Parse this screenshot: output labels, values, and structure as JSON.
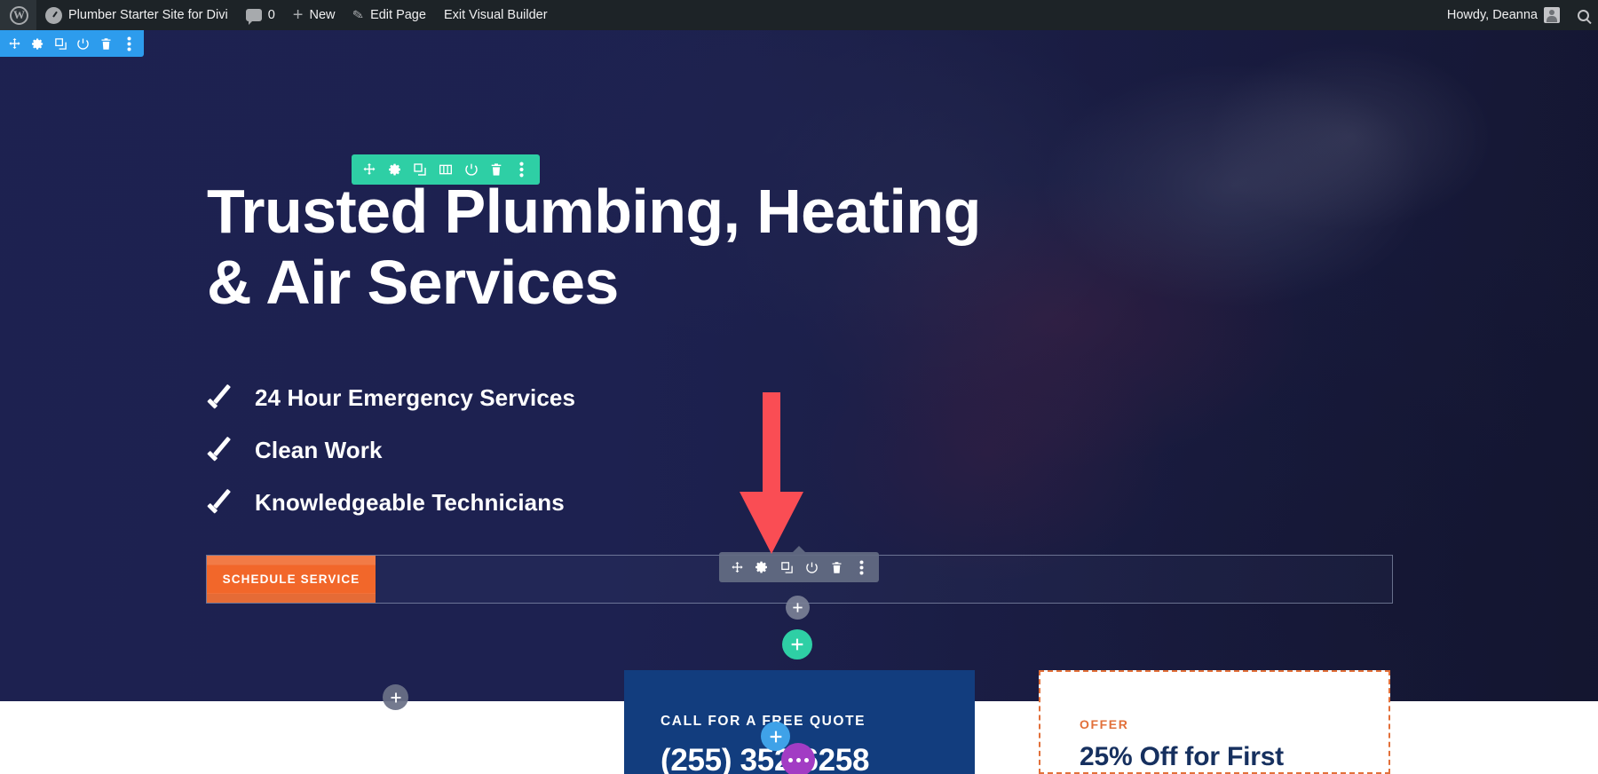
{
  "adminbar": {
    "wp_logo": "wordpress-logo-icon",
    "site_name": "Plumber Starter Site for Divi",
    "comments_count": "0",
    "new_label": "New",
    "edit_page_label": "Edit Page",
    "exit_visual_builder_label": "Exit Visual Builder",
    "howdy": "Howdy, Deanna",
    "search_icon": "search-icon"
  },
  "toolbars": {
    "section": {
      "color": "#2d9ced",
      "buttons": [
        "move-icon",
        "gear-icon",
        "duplicate-icon",
        "disable-icon",
        "trash-icon",
        "more-options-icon"
      ]
    },
    "row": {
      "color": "#2ecfa5",
      "buttons": [
        "move-icon",
        "gear-icon",
        "duplicate-icon",
        "columns-icon",
        "disable-icon",
        "trash-icon",
        "more-options-icon"
      ]
    },
    "module": {
      "color": "#646c83",
      "buttons": [
        "move-icon",
        "gear-icon",
        "duplicate-icon",
        "disable-icon",
        "trash-icon",
        "more-options-icon"
      ]
    }
  },
  "hero": {
    "title": "Trusted Plumbing, Heating & Air Services",
    "features": [
      "24 Hour Emergency Services",
      "Clean Work",
      "Knowledgeable Technicians"
    ],
    "cta_label": "SCHEDULE SERVICE",
    "cta_color": "#f2672a",
    "background_color": "#1d2150"
  },
  "add_buttons": {
    "add_row": "+",
    "add_section": "+",
    "add_left": "+",
    "add_quote": "+",
    "options": "more-options-icon"
  },
  "annotation": {
    "arrow": "down-arrow-annotation",
    "arrow_color": "#fa4d54"
  },
  "cards": {
    "phone": {
      "label": "CALL FOR A FREE QUOTE",
      "number": "(255) 352-6258",
      "background": "#123d7e"
    },
    "offer": {
      "tag": "OFFER",
      "title": "25% Off for First",
      "border_color": "#e2703a",
      "title_color": "#16305f"
    }
  }
}
